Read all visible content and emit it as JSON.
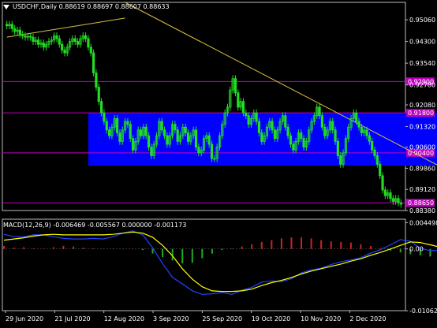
{
  "header": {
    "symbol": "USDCHF,Daily",
    "ohlc": "0.88619 0.88697 0.88607 0.88633",
    "macd_label": "MACD(12,26,9) -0.006469 -0.005567 0.000000 -0.001173"
  },
  "colors": {
    "background": "#000000",
    "candle": "#22dd22",
    "box": "#0000ff",
    "hline": "#c000c0",
    "trendline": "#d8c040",
    "axis": "#bbbbbb",
    "macd_signal": "#ffff00",
    "macd_line": "#2244ff",
    "hist_pos": "#cc2222",
    "hist_neg": "#22aa22"
  },
  "chart_data": [
    {
      "type": "candlestick",
      "title": "USDCHF,Daily",
      "ylim": [
        0.8838,
        0.9567
      ],
      "y_ticks": [
        "0.95060",
        "0.94300",
        "0.93540",
        "0.92780",
        "0.92080",
        "0.91320",
        "0.90600",
        "0.89860",
        "0.89120",
        "0.88380"
      ],
      "x_ticks": [
        "29 Jun 2020",
        "21 Jul 2020",
        "12 Aug 2020",
        "3 Sep 2020",
        "25 Sep 2020",
        "19 Oct 2020",
        "10 Nov 2020",
        "2 Dec 2020"
      ],
      "horizontal_levels": [
        {
          "label": "0.92900",
          "value": 0.929
        },
        {
          "label": "0.91800",
          "value": 0.918
        },
        {
          "label": "0.90400",
          "value": 0.904
        },
        {
          "label": "0.88650",
          "value": 0.8865
        }
      ],
      "range_box": {
        "y_top": 0.918,
        "y_bottom": 0.8995,
        "x_start_index": 31,
        "x_end_index": 263
      },
      "trendlines": [
        {
          "x1": 0,
          "y1": 0.9445,
          "x2": 45,
          "y2": 0.9512
        },
        {
          "x1": 45,
          "y1": 0.9567,
          "x2": 286,
          "y2": 0.8998
        }
      ],
      "closes": [
        0.9485,
        0.949,
        0.9475,
        0.9465,
        0.947,
        0.9455,
        0.945,
        0.9445,
        0.9448,
        0.9445,
        0.943,
        0.9435,
        0.942,
        0.9425,
        0.941,
        0.942,
        0.943,
        0.9435,
        0.945,
        0.944,
        0.942,
        0.94,
        0.939,
        0.941,
        0.943,
        0.944,
        0.943,
        0.942,
        0.944,
        0.945,
        0.944,
        0.941,
        0.939,
        0.932,
        0.927,
        0.922,
        0.918,
        0.915,
        0.912,
        0.91,
        0.913,
        0.916,
        0.911,
        0.908,
        0.912,
        0.915,
        0.914,
        0.909,
        0.905,
        0.908,
        0.912,
        0.91,
        0.913,
        0.91,
        0.906,
        0.903,
        0.907,
        0.91,
        0.915,
        0.912,
        0.91,
        0.907,
        0.91,
        0.914,
        0.912,
        0.908,
        0.91,
        0.913,
        0.911,
        0.908,
        0.91,
        0.912,
        0.906,
        0.904,
        0.905,
        0.909,
        0.91,
        0.907,
        0.902,
        0.902,
        0.906,
        0.91,
        0.914,
        0.918,
        0.92,
        0.926,
        0.93,
        0.925,
        0.92,
        0.922,
        0.918,
        0.917,
        0.914,
        0.916,
        0.918,
        0.915,
        0.911,
        0.908,
        0.91,
        0.913,
        0.915,
        0.912,
        0.909,
        0.912,
        0.915,
        0.917,
        0.913,
        0.91,
        0.907,
        0.905,
        0.908,
        0.911,
        0.909,
        0.906,
        0.908,
        0.912,
        0.915,
        0.917,
        0.92,
        0.917,
        0.913,
        0.91,
        0.912,
        0.915,
        0.912,
        0.908,
        0.903,
        0.9,
        0.904,
        0.909,
        0.913,
        0.916,
        0.918,
        0.915,
        0.913,
        0.911,
        0.912,
        0.91,
        0.908,
        0.905,
        0.903,
        0.9,
        0.896,
        0.891,
        0.889,
        0.89,
        0.888,
        0.887,
        0.888,
        0.8865,
        0.886
      ]
    },
    {
      "type": "macd",
      "title": "MACD(12,26,9)",
      "ylim": [
        -0.0106,
        0.0051
      ],
      "y_ticks": [
        "0.004498",
        "0.00",
        "-0.010621"
      ],
      "macd": [
        0.0025,
        0.0021,
        0.0021,
        0.0024,
        0.0024,
        0.0021,
        0.0018,
        0.0017,
        0.0017,
        0.0018,
        0.0017,
        0.0021,
        0.0027,
        0.0031,
        0.0024,
        0.0002,
        -0.0025,
        -0.0049,
        -0.006,
        -0.0072,
        -0.0078,
        -0.0077,
        -0.0075,
        -0.0078,
        -0.0071,
        -0.0066,
        -0.0057,
        -0.0055,
        -0.0056,
        -0.0051,
        -0.0041,
        -0.0036,
        -0.0033,
        -0.0027,
        -0.0022,
        -0.0019,
        -0.0015,
        -0.0007,
        -0.0001,
        0.0007,
        0.0016,
        0.0013,
        0.0001,
        -0.0003,
        -0.0003,
        -0.0001,
        -0.0002,
        -0.0007,
        -0.0012,
        -0.0011,
        -0.0012,
        -0.0004,
        0.0002,
        0.0,
        -0.0004,
        -0.0018,
        -0.0038,
        -0.0051,
        -0.0057,
        -0.0065
      ],
      "signal": [
        0.0015,
        0.0017,
        0.0019,
        0.0022,
        0.0024,
        0.0025,
        0.0024,
        0.0024,
        0.0024,
        0.0024,
        0.0024,
        0.0025,
        0.0027,
        0.0029,
        0.0027,
        0.002,
        0.0006,
        -0.0012,
        -0.0034,
        -0.0052,
        -0.0065,
        -0.0072,
        -0.0073,
        -0.0073,
        -0.0072,
        -0.0069,
        -0.0063,
        -0.0058,
        -0.0054,
        -0.0049,
        -0.0043,
        -0.0038,
        -0.0034,
        -0.003,
        -0.0026,
        -0.0021,
        -0.0017,
        -0.0011,
        -0.0006,
        0.0,
        0.0006,
        0.0012,
        0.0011,
        0.0007,
        0.0003,
        0.0002,
        0.0001,
        -0.0003,
        -0.0004,
        -0.0003,
        -0.0001,
        0.0001,
        0.0003,
        0.0002,
        -0.0002,
        -0.001,
        -0.002,
        -0.003,
        -0.0042,
        -0.0054
      ],
      "histogram": [
        0.0005,
        0.0002,
        0.0003,
        0.0001,
        0.0,
        0.0003,
        0.0005,
        0.0004,
        0.0002,
        0.0001,
        0.0,
        0.0,
        0.0,
        0.0,
        -0.0002,
        -0.0008,
        -0.0014,
        -0.002,
        -0.0025,
        -0.0024,
        -0.0016,
        -0.0008,
        -0.0002,
        0.0001,
        0.0004,
        0.0008,
        0.0012,
        0.0015,
        0.0018,
        0.002,
        0.002,
        0.0018,
        0.0015,
        0.0013,
        0.0012,
        0.0011,
        0.0008,
        0.0005,
        0.0001,
        -0.0003,
        -0.0006,
        -0.0009,
        -0.0011,
        -0.0013,
        -0.0012,
        -0.0009,
        -0.0006,
        -0.0002,
        0.0001,
        0.0003,
        0.0002,
        0.0,
        -0.0003,
        -0.0006,
        -0.001,
        -0.0014,
        -0.0017,
        -0.0019,
        -0.0017,
        -0.0013
      ],
      "zero_line": 0.0
    }
  ]
}
